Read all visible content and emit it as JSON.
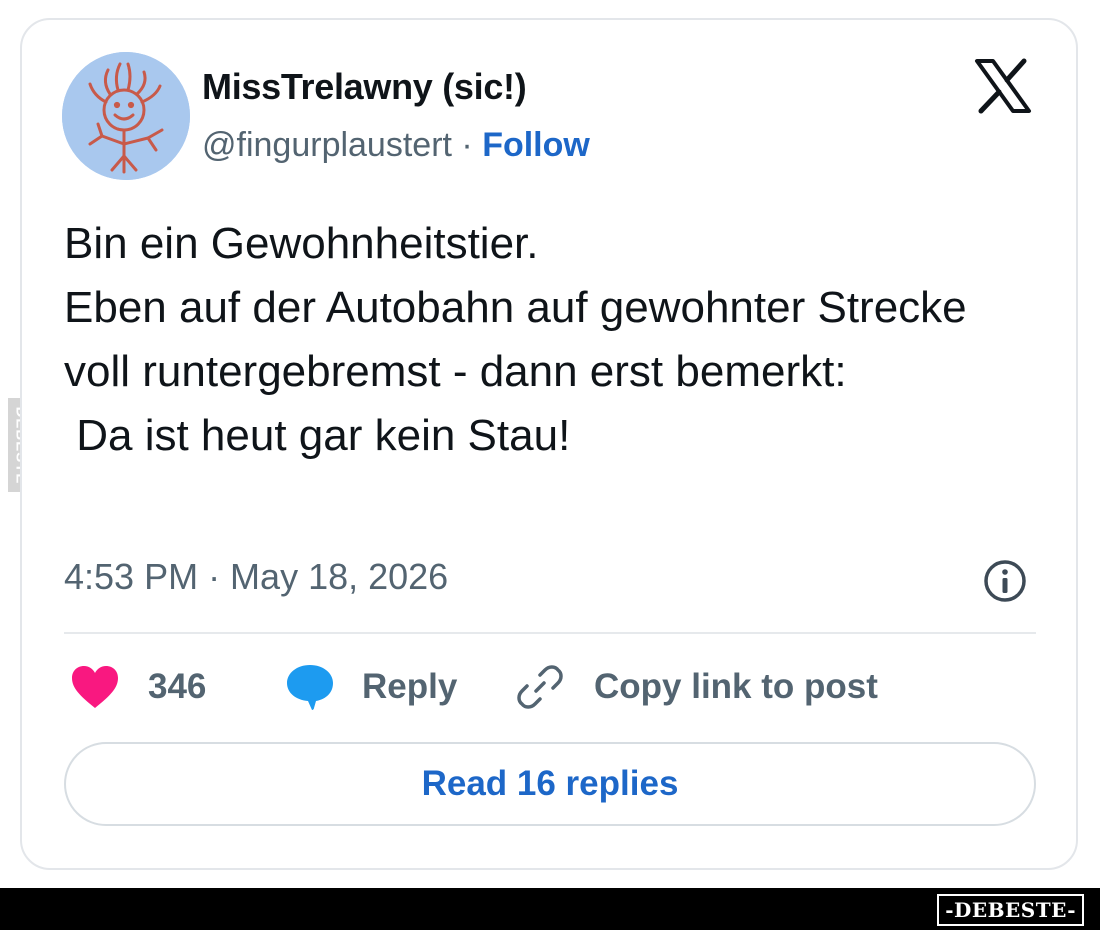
{
  "post": {
    "author": {
      "display_name": "MissTrelawny (sic!)",
      "handle": "@fingurplaustert",
      "separator": " · ",
      "follow_label": "Follow",
      "avatar_icon": "drawn-smiley-figure-avatar"
    },
    "platform_icon": "x-logo-icon",
    "text": "Bin ein Gewohnheitstier.\nEben auf der Autobahn auf gewohnter Strecke voll runtergebremst - dann erst bemerkt:\n Da ist heut gar kein Stau!",
    "timestamp": "4:53 PM · May 18, 2026",
    "info_icon": "info-circle-icon",
    "actions": {
      "like_count": "346",
      "like_icon": "heart-icon",
      "reply_label": "Reply",
      "reply_icon": "speech-bubble-icon",
      "copy_label": "Copy link to post",
      "copy_icon": "link-icon"
    },
    "read_replies_label": "Read 16 replies"
  },
  "watermark": {
    "side_text": "DEBESTE",
    "bottom_text": "-DEBESTE-"
  },
  "colors": {
    "link_blue": "#1d67c8",
    "like_pink": "#f91880",
    "reply_blue": "#1d9bf0",
    "muted_gray": "#536471",
    "text_dark": "#0f1419"
  }
}
